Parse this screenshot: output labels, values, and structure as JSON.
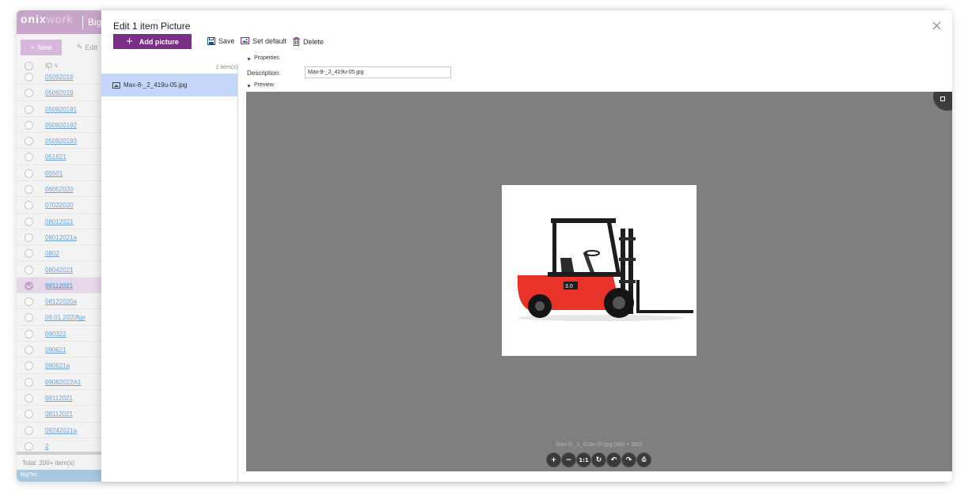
{
  "background": {
    "logo_main": "onix",
    "logo_work": "work",
    "brand": "Big",
    "new_label": "New",
    "edit_label": "Edit",
    "column_id": "ID",
    "ids": [
      "05092019",
      "05092019",
      "050920191",
      "050920192",
      "050920193",
      "051821",
      "05501",
      "06052020",
      "07022020",
      "08012021",
      "08012021a",
      "0802",
      "08042021",
      "08112021",
      "08122020a",
      "09.01.2020fge",
      "090322",
      "090621",
      "090621a",
      "09082022A1",
      "09112021",
      "08112021",
      "09242021a",
      "2"
    ],
    "selected_id": "08112021",
    "total": "Total: 200+ item(s)",
    "status": "BigTec"
  },
  "modal": {
    "title": "Edit 1 item Picture",
    "add_picture": "Add picture",
    "save": "Save",
    "set_default": "Set default",
    "delete": "Delete",
    "item_count": "1 item(s)",
    "file_name": "Max-8-_2_419u-05.jpg",
    "properties_label": "Properties",
    "description_label": "Description:",
    "description_value": "Max-8-_2_419u-05.jpg",
    "preview_label": "Preview",
    "preview_caption": "Max-8-_2_419u-05.jpg (400 × 350)",
    "controls": [
      "+",
      "−",
      "1:1",
      "↻",
      "↶",
      "↷",
      "⎙"
    ]
  },
  "colors": {
    "accent": "#7b2e87",
    "selection": "#c4d6fa",
    "preview_bg": "#7f7f7f",
    "forklift_red": "#e8332a"
  }
}
